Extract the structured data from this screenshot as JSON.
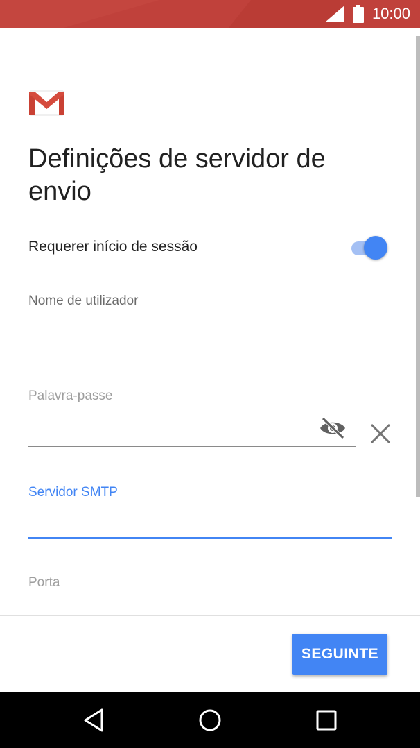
{
  "status_bar": {
    "time": "10:00",
    "icons": [
      "signal-icon",
      "battery-icon"
    ],
    "color": "#c0413b"
  },
  "app": {
    "logo": "gmail-logo"
  },
  "page": {
    "title": "Definições de servidor de envio"
  },
  "require_signin": {
    "label": "Requerer início de sessão",
    "enabled": true
  },
  "fields": {
    "username": {
      "label": "Nome de utilizador",
      "value": ""
    },
    "password": {
      "label": "Palavra-passe",
      "value": ""
    },
    "smtp_server": {
      "label": "Servidor SMTP",
      "value": ""
    },
    "port": {
      "label": "Porta",
      "value": ""
    }
  },
  "actions": {
    "next_label": "SEGUINTE"
  },
  "navigation": {
    "icons": [
      "back-icon",
      "home-icon",
      "recent-apps-icon"
    ]
  },
  "colors": {
    "accent": "#4285f4",
    "status_bar": "#c0413b",
    "text_primary": "#212121"
  }
}
